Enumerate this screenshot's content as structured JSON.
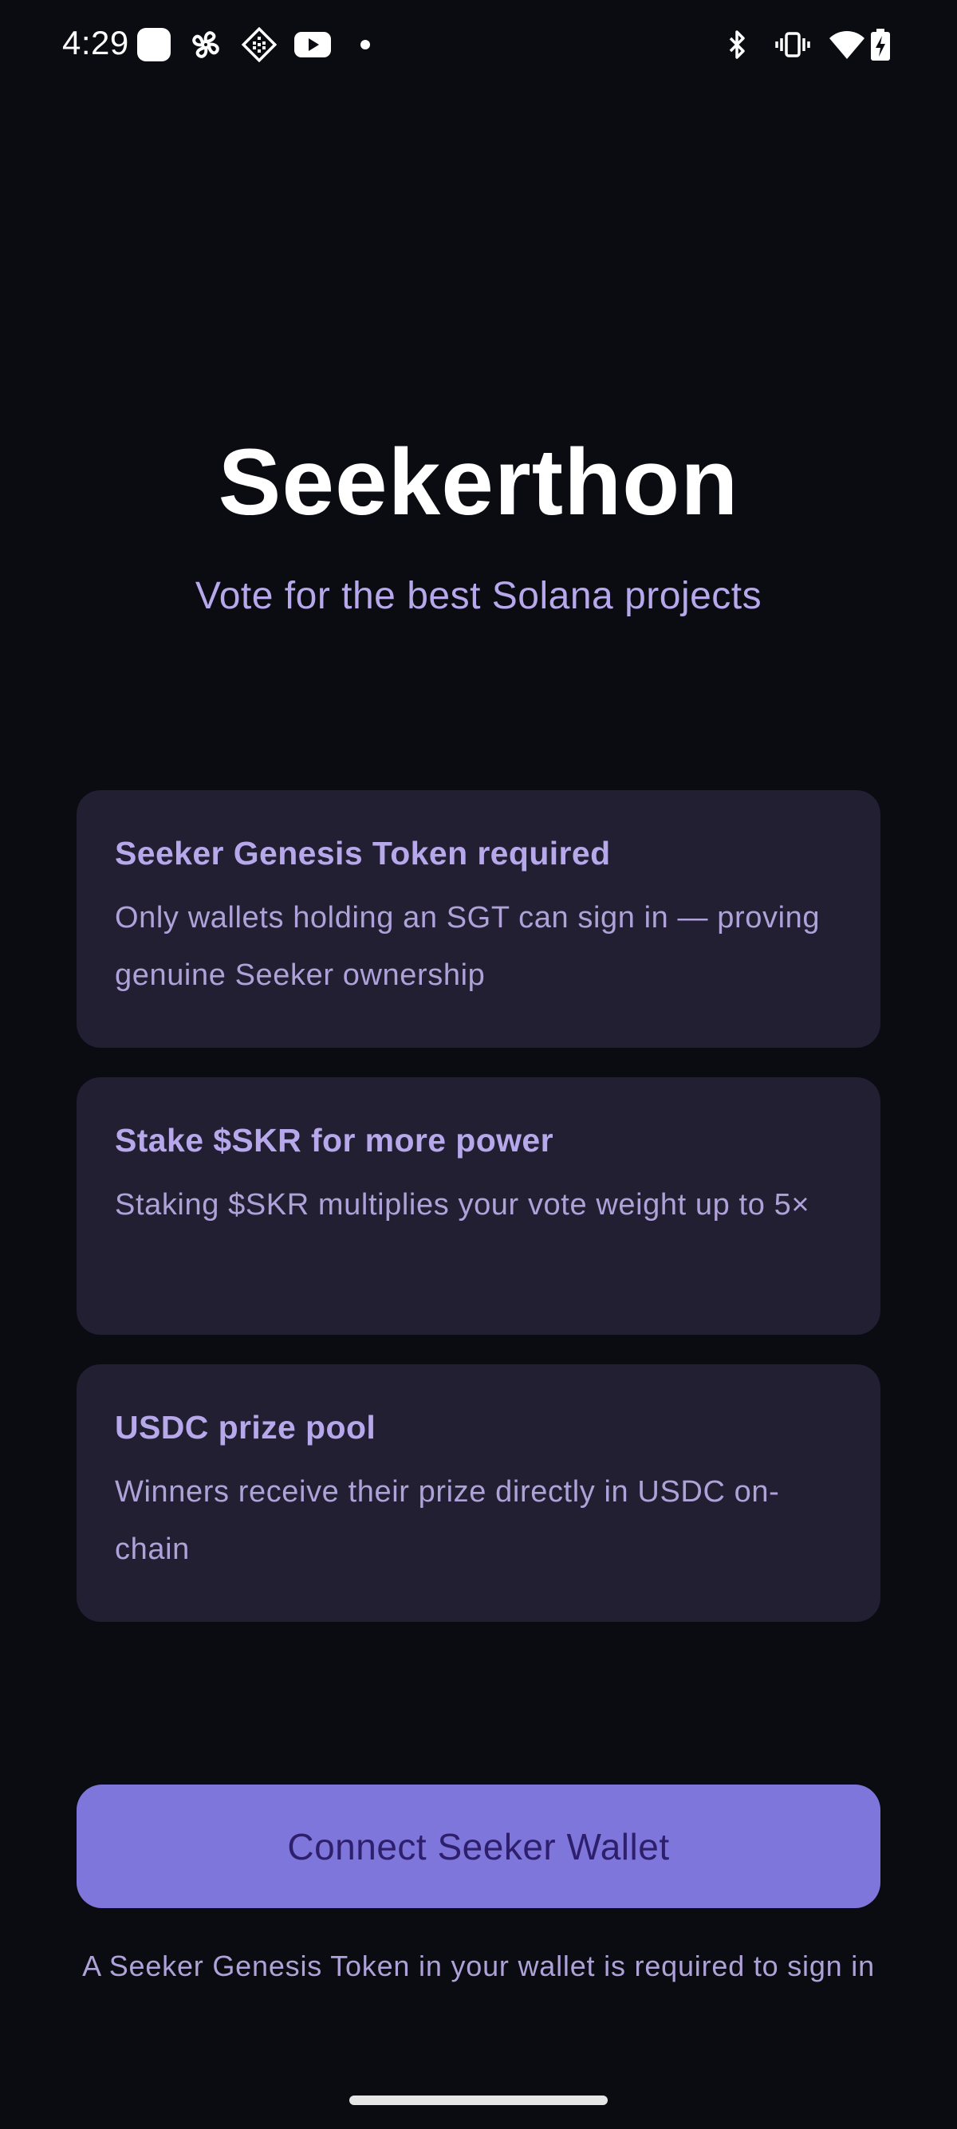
{
  "status_bar": {
    "time": "4:29",
    "left_icons": [
      "app-icon",
      "pinwheel-icon",
      "diamond-grid-icon",
      "youtube-icon",
      "dot-icon"
    ],
    "right_icons": [
      "bluetooth-icon",
      "vibrate-icon",
      "wifi-icon",
      "battery-charging-icon"
    ]
  },
  "header": {
    "title": "Seekerthon",
    "subtitle": "Vote for the best Solana projects"
  },
  "cards": [
    {
      "title": "Seeker Genesis Token required",
      "text": "Only wallets holding an SGT can sign in — proving genuine Seeker ownership"
    },
    {
      "title": "Stake $SKR for more power",
      "text": "Staking $SKR multiplies your vote weight up to 5×"
    },
    {
      "title": "USDC prize pool",
      "text": "Winners receive their prize directly in USDC on-chain"
    }
  ],
  "actions": {
    "connect_label": "Connect Seeker Wallet",
    "footnote": "A Seeker Genesis Token in your wallet is required to sign in"
  },
  "colors": {
    "background": "#0b0b12",
    "card": "#211f31",
    "accent": "#7f76dc",
    "accent_text": "#b7a8ec"
  }
}
